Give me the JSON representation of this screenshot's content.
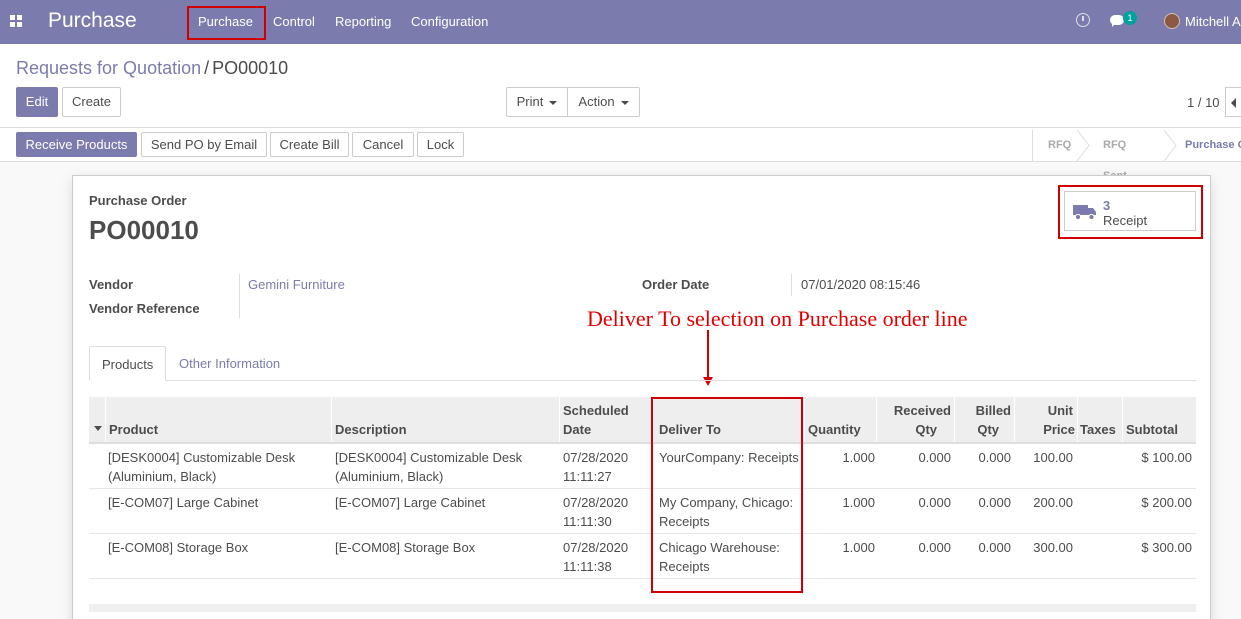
{
  "navbar": {
    "app_title": "Purchase",
    "menu": [
      "Purchase",
      "Control",
      "Reporting",
      "Configuration"
    ],
    "message_count": "1",
    "user_name": "Mitchell Admin",
    "icons": [
      "apps-grid-icon",
      "clock-icon",
      "chat-icon",
      "avatar"
    ]
  },
  "breadcrumb": {
    "parent": "Requests for Quotation",
    "separator": "/",
    "current": "PO00010"
  },
  "buttons": {
    "edit": "Edit",
    "create": "Create",
    "print": "Print",
    "action": "Action"
  },
  "pager": {
    "value": "1 / 10"
  },
  "header_buttons": {
    "receive_products": "Receive Products",
    "send_po_email": "Send PO by Email",
    "create_bill": "Create Bill",
    "cancel": "Cancel",
    "lock": "Lock"
  },
  "statusbar": {
    "steps": [
      "RFQ",
      "RFQ Sent",
      "Purchase Order"
    ],
    "active": "Purchase Order"
  },
  "form": {
    "type_label": "Purchase Order",
    "name": "PO00010",
    "smart_button": {
      "count": "3",
      "label": "Receipt"
    },
    "vendor_label": "Vendor",
    "vendor_value": "Gemini Furniture",
    "vendor_reference_label": "Vendor Reference",
    "vendor_reference_value": "",
    "order_date_label": "Order Date",
    "order_date_value": "07/01/2020 08:15:46"
  },
  "annotation": {
    "text": "Deliver To selection on Purchase order line"
  },
  "tabs": [
    "Products",
    "Other Information"
  ],
  "lines": {
    "headers": {
      "product": "Product",
      "description": "Description",
      "scheduled_date_1": "Scheduled",
      "scheduled_date_2": "Date",
      "deliver_to": "Deliver To",
      "quantity": "Quantity",
      "received_1": "Received",
      "received_2": "Qty",
      "billed_1": "Billed",
      "billed_2": "Qty",
      "unit_1": "Unit",
      "unit_2": "Price",
      "taxes": "Taxes",
      "subtotal": "Subtotal"
    },
    "rows": [
      {
        "product_1": "[DESK0004] Customizable Desk",
        "product_2": "(Aluminium, Black)",
        "description_1": "[DESK0004] Customizable Desk",
        "description_2": "(Aluminium, Black)",
        "date_1": "07/28/2020",
        "date_2": "11:11:27",
        "deliver_1": "YourCompany: Receipts",
        "deliver_2": "",
        "quantity": "1.000",
        "received": "0.000",
        "billed": "0.000",
        "unit_price": "100.00",
        "taxes": "",
        "subtotal": "$ 100.00"
      },
      {
        "product_1": "[E-COM07] Large Cabinet",
        "product_2": "",
        "description_1": "[E-COM07] Large Cabinet",
        "description_2": "",
        "date_1": "07/28/2020",
        "date_2": "11:11:30",
        "deliver_1": "My Company, Chicago:",
        "deliver_2": "Receipts",
        "quantity": "1.000",
        "received": "0.000",
        "billed": "0.000",
        "unit_price": "200.00",
        "taxes": "",
        "subtotal": "$ 200.00"
      },
      {
        "product_1": "[E-COM08] Storage Box",
        "product_2": "",
        "description_1": "[E-COM08] Storage Box",
        "description_2": "",
        "date_1": "07/28/2020",
        "date_2": "11:11:38",
        "deliver_1": "Chicago Warehouse:",
        "deliver_2": "Receipts",
        "quantity": "1.000",
        "received": "0.000",
        "billed": "0.000",
        "unit_price": "300.00",
        "taxes": "",
        "subtotal": "$ 300.00"
      }
    ]
  },
  "colors": {
    "brand": "#7c7bad",
    "highlight": "#d10000",
    "text": "#4c4c4c"
  }
}
